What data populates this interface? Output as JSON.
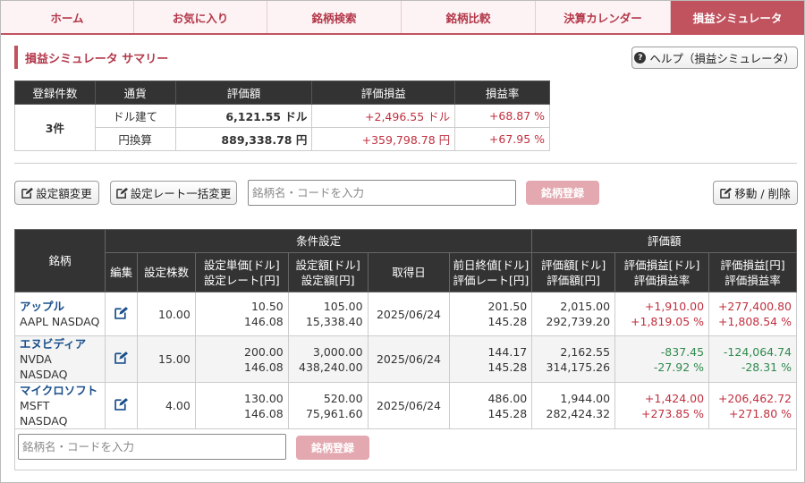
{
  "tabs": [
    {
      "label": "ホーム",
      "active": false
    },
    {
      "label": "お気に入り",
      "active": false
    },
    {
      "label": "銘柄検索",
      "active": false
    },
    {
      "label": "銘柄比較",
      "active": false
    },
    {
      "label": "決算カレンダー",
      "active": false
    },
    {
      "label": "損益シミュレータ",
      "active": true
    }
  ],
  "summary": {
    "title": "損益シミュレータ サマリー",
    "help_label": "ヘルプ（損益シミュレータ）",
    "headers": [
      "登録件数",
      "通貨",
      "評価額",
      "評価損益",
      "損益率"
    ],
    "count": "3件",
    "rows": [
      {
        "currency": "ドル建て",
        "value": "6,121.55 ドル",
        "pl": "+2,496.55 ドル",
        "rate": "+68.87 %"
      },
      {
        "currency": "円換算",
        "value": "889,338.78 円",
        "pl": "+359,798.78 円",
        "rate": "+67.95 %"
      }
    ]
  },
  "toolbar": {
    "edit_amount_label": "設定額変更",
    "edit_rate_label": "設定レート一括変更",
    "search_placeholder": "銘柄名・コードを入力",
    "register_label": "銘柄登録",
    "move_delete_label": "移動 / 削除"
  },
  "holdings": {
    "group_headers": {
      "stock": "銘柄",
      "settings": "条件設定",
      "valuation": "評価額"
    },
    "sub_headers": {
      "edit": "編集",
      "shares": "設定株数",
      "unit_price": [
        "設定単価[ドル]",
        "設定レート[円]"
      ],
      "amount": [
        "設定額[ドル]",
        "設定額[円]"
      ],
      "acquired": "取得日",
      "prev_close": [
        "前日終値[ドル]",
        "評価レート[円]"
      ],
      "eval_value": [
        "評価額[ドル]",
        "評価額[円]"
      ],
      "eval_pl_usd": [
        "評価損益[ドル]",
        "評価損益率"
      ],
      "eval_pl_jpy": [
        "評価損益[円]",
        "評価損益率"
      ]
    },
    "rows": [
      {
        "name": "アップル",
        "code": "AAPL NASDAQ",
        "shares": "10.00",
        "unit_price": "10.50",
        "rate": "146.08",
        "amount_usd": "105.00",
        "amount_jpy": "15,338.40",
        "acquired": "2025/06/24",
        "prev_close": "201.50",
        "eval_rate": "145.28",
        "eval_usd": "2,015.00",
        "eval_jpy": "292,739.20",
        "pl_usd": "+1,910.00",
        "pl_usd_rate": "+1,819.05 %",
        "pl_jpy": "+277,400.80",
        "pl_jpy_rate": "+1,808.54 %",
        "positive": true
      },
      {
        "name": "エヌビディア",
        "code": "NVDA NASDAQ",
        "shares": "15.00",
        "unit_price": "200.00",
        "rate": "146.08",
        "amount_usd": "3,000.00",
        "amount_jpy": "438,240.00",
        "acquired": "2025/06/24",
        "prev_close": "144.17",
        "eval_rate": "145.28",
        "eval_usd": "2,162.55",
        "eval_jpy": "314,175.26",
        "pl_usd": "-837.45",
        "pl_usd_rate": "-27.92 %",
        "pl_jpy": "-124,064.74",
        "pl_jpy_rate": "-28.31 %",
        "positive": false
      },
      {
        "name": "マイクロソフト",
        "code": "MSFT NASDAQ",
        "shares": "4.00",
        "unit_price": "130.00",
        "rate": "146.08",
        "amount_usd": "520.00",
        "amount_jpy": "75,961.60",
        "acquired": "2025/06/24",
        "prev_close": "486.00",
        "eval_rate": "145.28",
        "eval_usd": "1,944.00",
        "eval_jpy": "282,424.32",
        "pl_usd": "+1,424.00",
        "pl_usd_rate": "+273.85 %",
        "pl_jpy": "+206,462.72",
        "pl_jpy_rate": "+271.80 %",
        "positive": true
      }
    ]
  },
  "bottom": {
    "search_placeholder": "銘柄名・コードを入力",
    "register_label": "銘柄登録"
  },
  "colors": {
    "accent": "#c1535f",
    "positive": "#c0303f",
    "negative": "#2f8a4e",
    "link": "#1a4f8b"
  }
}
